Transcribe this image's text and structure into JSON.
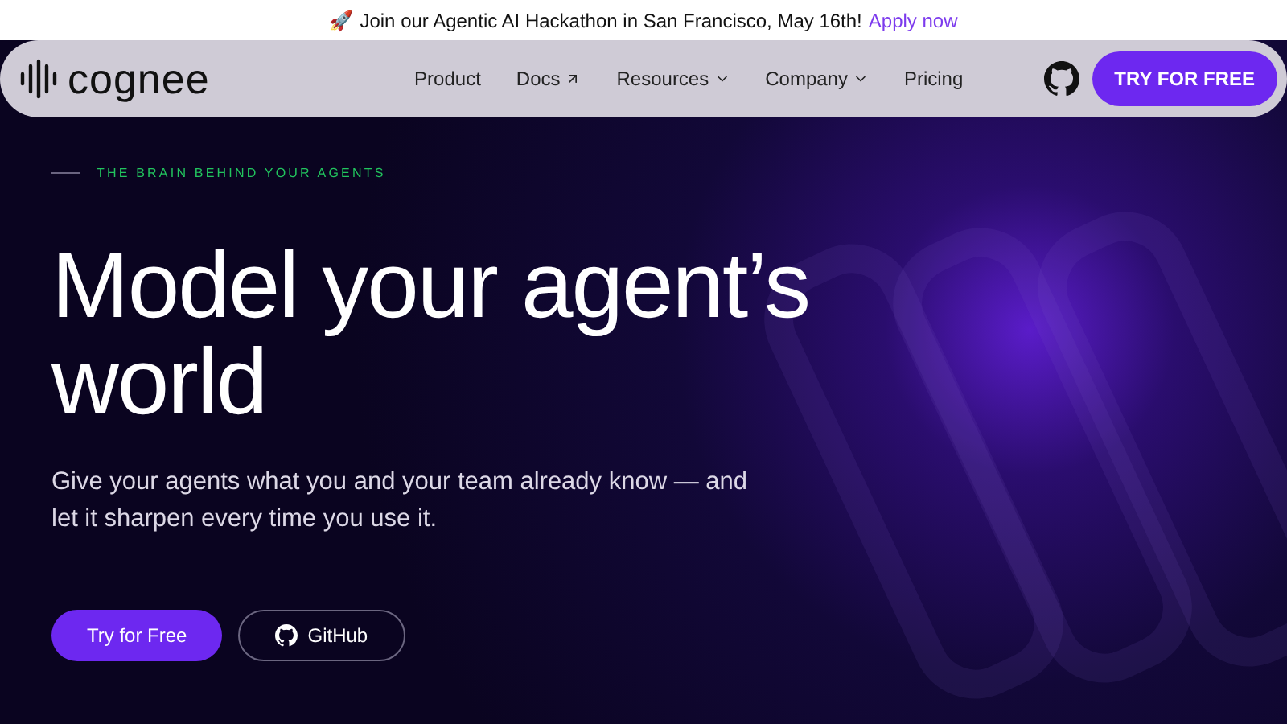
{
  "announcement": {
    "icon": "🚀",
    "text": "Join our Agentic AI Hackathon in San Francisco, May 16th!",
    "link": "Apply now"
  },
  "nav": {
    "logo": "cognee",
    "items": [
      {
        "label": "Product",
        "kind": "link"
      },
      {
        "label": "Docs",
        "kind": "external"
      },
      {
        "label": "Resources",
        "kind": "dropdown"
      },
      {
        "label": "Company",
        "kind": "dropdown"
      },
      {
        "label": "Pricing",
        "kind": "link"
      }
    ],
    "cta": "TRY FOR FREE"
  },
  "hero": {
    "eyebrow": "THE BRAIN BEHIND YOUR AGENTS",
    "title": "Model your agent’s world",
    "subtitle": "Give your agents what you and your team already know — and let it sharpen every time you use it.",
    "buttons": [
      {
        "label": "Try for Free",
        "kind": "primary"
      },
      {
        "label": "GitHub",
        "kind": "outline"
      }
    ]
  }
}
